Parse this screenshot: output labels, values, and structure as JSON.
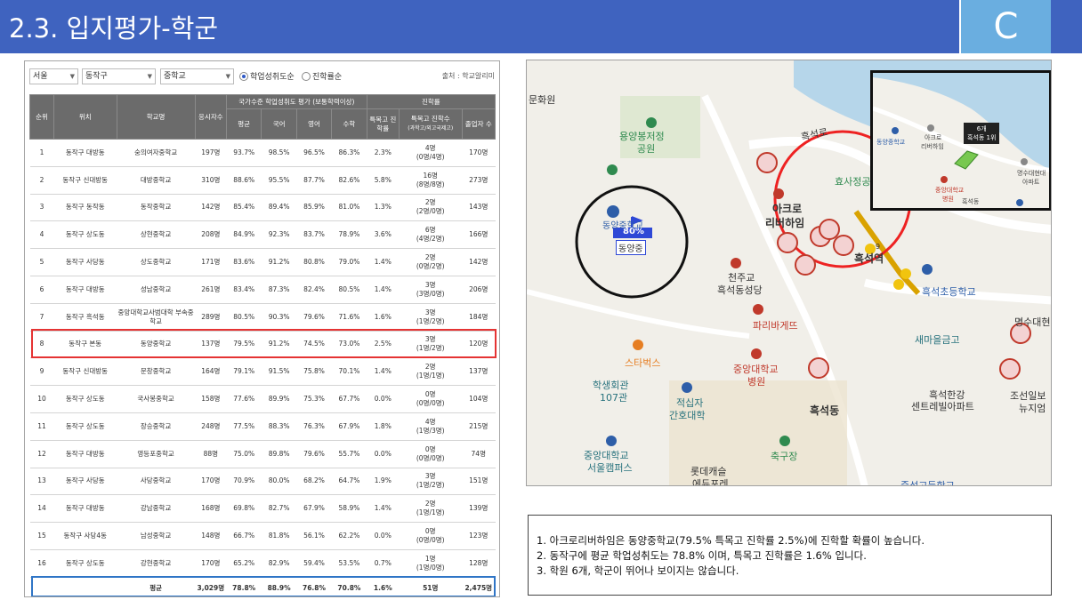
{
  "header": {
    "title": "2.3. 입지평가-학군",
    "badge": "C"
  },
  "filters": {
    "region": "서울",
    "district": "동작구",
    "school_type": "중학교",
    "radio_1": "학업성취도순",
    "radio_2": "진학률순",
    "source": "출처 : 학교알리미"
  },
  "table": {
    "headers": {
      "rank": "순위",
      "location": "위치",
      "school": "학교명",
      "takers": "응시자수",
      "group_achievement": "국가수준 학업성취도 평가 (보통학력이상)",
      "group_advance": "진학률",
      "avg": "평균",
      "korean": "국어",
      "english": "영어",
      "math": "수학",
      "special_rate": "특목고 진학률",
      "special_count": "특목고 진학수",
      "special_count_sub": "(과학고/외고국제고)",
      "graduates": "졸업자 수"
    },
    "rows": [
      [
        "1",
        "동작구 대방동",
        "숭의여자중학교",
        "197명",
        "93.7%",
        "98.5%",
        "96.5%",
        "86.3%",
        "2.3%",
        "4명",
        "(0명/4명)",
        "170명"
      ],
      [
        "2",
        "동작구 신대방동",
        "대방중학교",
        "310명",
        "88.6%",
        "95.5%",
        "87.7%",
        "82.6%",
        "5.8%",
        "16명",
        "(8명/8명)",
        "273명"
      ],
      [
        "3",
        "동작구 동작동",
        "동작중학교",
        "142명",
        "85.4%",
        "89.4%",
        "85.9%",
        "81.0%",
        "1.3%",
        "2명",
        "(2명/0명)",
        "143명"
      ],
      [
        "4",
        "동작구 상도동",
        "상현중학교",
        "208명",
        "84.9%",
        "92.3%",
        "83.7%",
        "78.9%",
        "3.6%",
        "6명",
        "(4명/2명)",
        "166명"
      ],
      [
        "5",
        "동작구 사당동",
        "상도중학교",
        "171명",
        "83.6%",
        "91.2%",
        "80.8%",
        "79.0%",
        "1.4%",
        "2명",
        "(0명/2명)",
        "142명"
      ],
      [
        "6",
        "동작구 대방동",
        "성남중학교",
        "261명",
        "83.4%",
        "87.3%",
        "82.4%",
        "80.5%",
        "1.4%",
        "3명",
        "(3명/0명)",
        "206명"
      ],
      [
        "7",
        "동작구 흑석동",
        "중앙대학교사범대학 부속중학교",
        "289명",
        "80.5%",
        "90.3%",
        "79.6%",
        "71.6%",
        "1.6%",
        "3명",
        "(1명/2명)",
        "184명"
      ],
      [
        "8",
        "동작구 본동",
        "동양중학교",
        "137명",
        "79.5%",
        "91.2%",
        "74.5%",
        "73.0%",
        "2.5%",
        "3명",
        "(1명/2명)",
        "120명"
      ],
      [
        "9",
        "동작구 신대방동",
        "문창중학교",
        "164명",
        "79.1%",
        "91.5%",
        "75.8%",
        "70.1%",
        "1.4%",
        "2명",
        "(1명/1명)",
        "137명"
      ],
      [
        "10",
        "동작구 상도동",
        "국사봉중학교",
        "158명",
        "77.6%",
        "89.9%",
        "75.3%",
        "67.7%",
        "0.0%",
        "0명",
        "(0명/0명)",
        "104명"
      ],
      [
        "11",
        "동작구 상도동",
        "장승중학교",
        "248명",
        "77.5%",
        "88.3%",
        "76.3%",
        "67.9%",
        "1.8%",
        "4명",
        "(1명/3명)",
        "215명"
      ],
      [
        "12",
        "동작구 대방동",
        "영등포중학교",
        "88명",
        "75.0%",
        "89.8%",
        "79.6%",
        "55.7%",
        "0.0%",
        "0명",
        "(0명/0명)",
        "74명"
      ],
      [
        "13",
        "동작구 사당동",
        "사당중학교",
        "170명",
        "70.9%",
        "80.0%",
        "68.2%",
        "64.7%",
        "1.9%",
        "3명",
        "(1명/2명)",
        "151명"
      ],
      [
        "14",
        "동작구 대방동",
        "강남중학교",
        "168명",
        "69.8%",
        "82.7%",
        "67.9%",
        "58.9%",
        "1.4%",
        "2명",
        "(1명/1명)",
        "139명"
      ],
      [
        "15",
        "동작구 사당4동",
        "남성중학교",
        "148명",
        "66.7%",
        "81.8%",
        "56.1%",
        "62.2%",
        "0.0%",
        "0명",
        "(0명/0명)",
        "123명"
      ],
      [
        "16",
        "동작구 상도동",
        "강현중학교",
        "170명",
        "65.2%",
        "82.9%",
        "59.4%",
        "53.5%",
        "0.7%",
        "1명",
        "(1명/0명)",
        "128명"
      ]
    ],
    "average_row": [
      "",
      "",
      "평균",
      "3,029명",
      "78.8%",
      "88.9%",
      "76.8%",
      "70.8%",
      "1.6%",
      "51명",
      "",
      "2,475명"
    ]
  },
  "map": {
    "labels": {
      "academy": "문화원",
      "park1": "용양봉저정",
      "park1b": "공원",
      "road": "흑석로",
      "park2": "효사정공원",
      "school_short": "동양중",
      "school_full": "동양중학교",
      "rate": "80%",
      "apt1": "아크로",
      "apt1b": "리버하임",
      "station": "흑석역",
      "church": "천주교",
      "church2": "흑석동성당",
      "elementary": "흑석초등학교",
      "paris": "파리바게뜨",
      "bank": "새마을금고",
      "starbucks": "스타벅스",
      "hospital": "중앙대학교",
      "hospital2": "병원",
      "hall": "학생회관",
      "hall2": "107관",
      "nursing": "적십자",
      "nursing2": "간호대학",
      "dong": "흑석동",
      "center": "흑석한강",
      "center2": "센트레빌아파트",
      "univ": "중앙대학교",
      "univ2": "서울캠퍼스",
      "soccer": "축구장",
      "lotte": "롯데캐슬",
      "lotte2": "에듀포레",
      "myungsu": "명수대현",
      "joseon": "조선일보",
      "joseon2": "뉴지엄",
      "highschool": "중석고등학교",
      "station_no": "9"
    },
    "inset": {
      "badge": "6개",
      "badge2": "흑석동 1위",
      "school": "동양중학교",
      "apt": "아크로",
      "apt2": "리버하임",
      "myungsu": "명수대현대",
      "myungsu2": "아파트",
      "hospital": "중앙대학교",
      "hospital2": "병원",
      "dong": "흑석동"
    }
  },
  "notes": [
    "1. 아크로리버하임은 동양중학교(79.5% 특목고 진학률 2.5%)에 진학할 확률이 높습니다.",
    "2. 동작구에 평균 학업성취도는 78.8% 이며, 특목고 진학률은 1.6% 입니다.",
    "3. 학원 6개, 학군이 뛰어나 보이지는 않습니다."
  ],
  "colors": {
    "header_bg": "#3f63bf",
    "badge_bg": "#6aaee0",
    "table_header": "#6b6b6b",
    "highlight_red": "#e53333",
    "highlight_blue": "#2f75c6"
  }
}
